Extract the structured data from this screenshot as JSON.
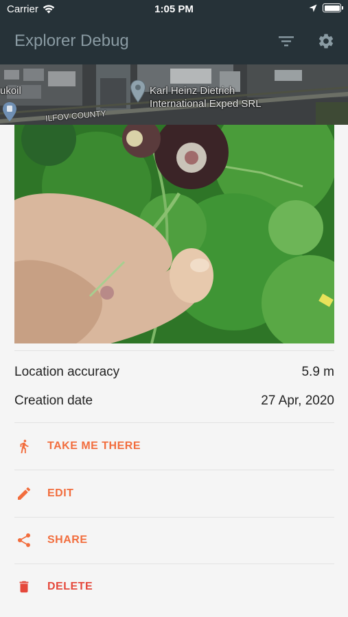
{
  "status_bar": {
    "carrier": "Carrier",
    "time": "1:05 PM"
  },
  "app_bar": {
    "title": "Explorer Debug",
    "filter_icon": "filter-icon",
    "settings_icon": "gear-icon"
  },
  "map": {
    "labels": {
      "poi_left": "ukoil",
      "poi_name_line1": "Karl Heinz Dietrich",
      "poi_name_line2": "International Exped SRL",
      "county": "ILFOV COUNTY"
    }
  },
  "details": {
    "accuracy_label": "Location accuracy",
    "accuracy_value": "5.9 m",
    "date_label": "Creation date",
    "date_value": "27 Apr, 2020"
  },
  "actions": {
    "take_me_there": "TAKE ME THERE",
    "edit": "EDIT",
    "share": "SHARE",
    "delete": "DELETE"
  },
  "colors": {
    "app_bar": "#263238",
    "accent": "#f26d3d",
    "danger": "#e5483b"
  }
}
